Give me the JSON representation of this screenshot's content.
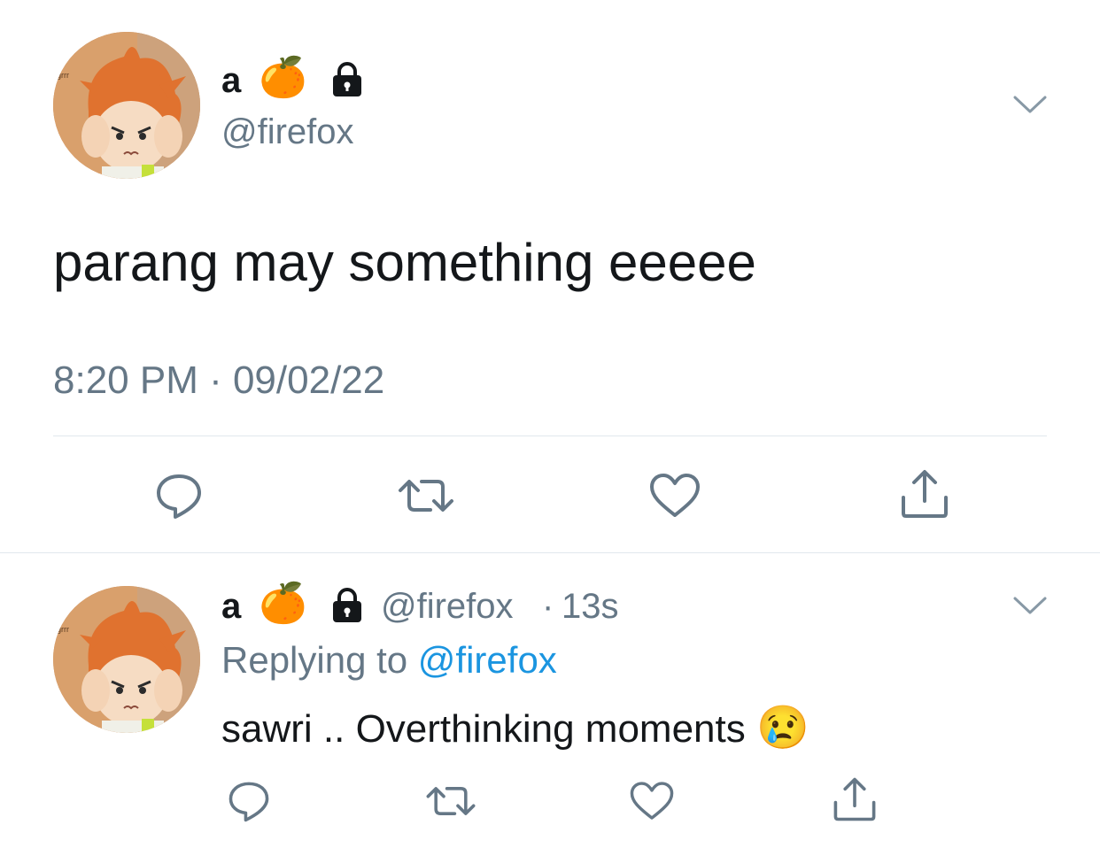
{
  "main_tweet": {
    "display_name": "a",
    "name_emoji": "🍊",
    "lock_icon": "lock-icon",
    "handle": "@firefox",
    "avatar_caption": "grrr",
    "text": "parang may something eeeee",
    "timestamp": "8:20 PM · 09/02/22",
    "actions": [
      "reply-icon",
      "retweet-icon",
      "like-icon",
      "share-icon"
    ]
  },
  "reply_tweet": {
    "display_name": "a",
    "name_emoji": "🍊",
    "handle": "@firefox",
    "separator": "·",
    "time_ago": "13s",
    "replying_prefix": "Replying to",
    "replying_to": "@firefox",
    "text": "sawri .. Overthinking moments",
    "text_emoji": "😢",
    "avatar_caption": "grrr",
    "actions": [
      "reply-icon",
      "retweet-icon",
      "like-icon",
      "share-icon"
    ]
  },
  "colors": {
    "text": "#14171a",
    "secondary": "#657786",
    "link": "#1b95e0",
    "divider": "#e1e8ed"
  }
}
